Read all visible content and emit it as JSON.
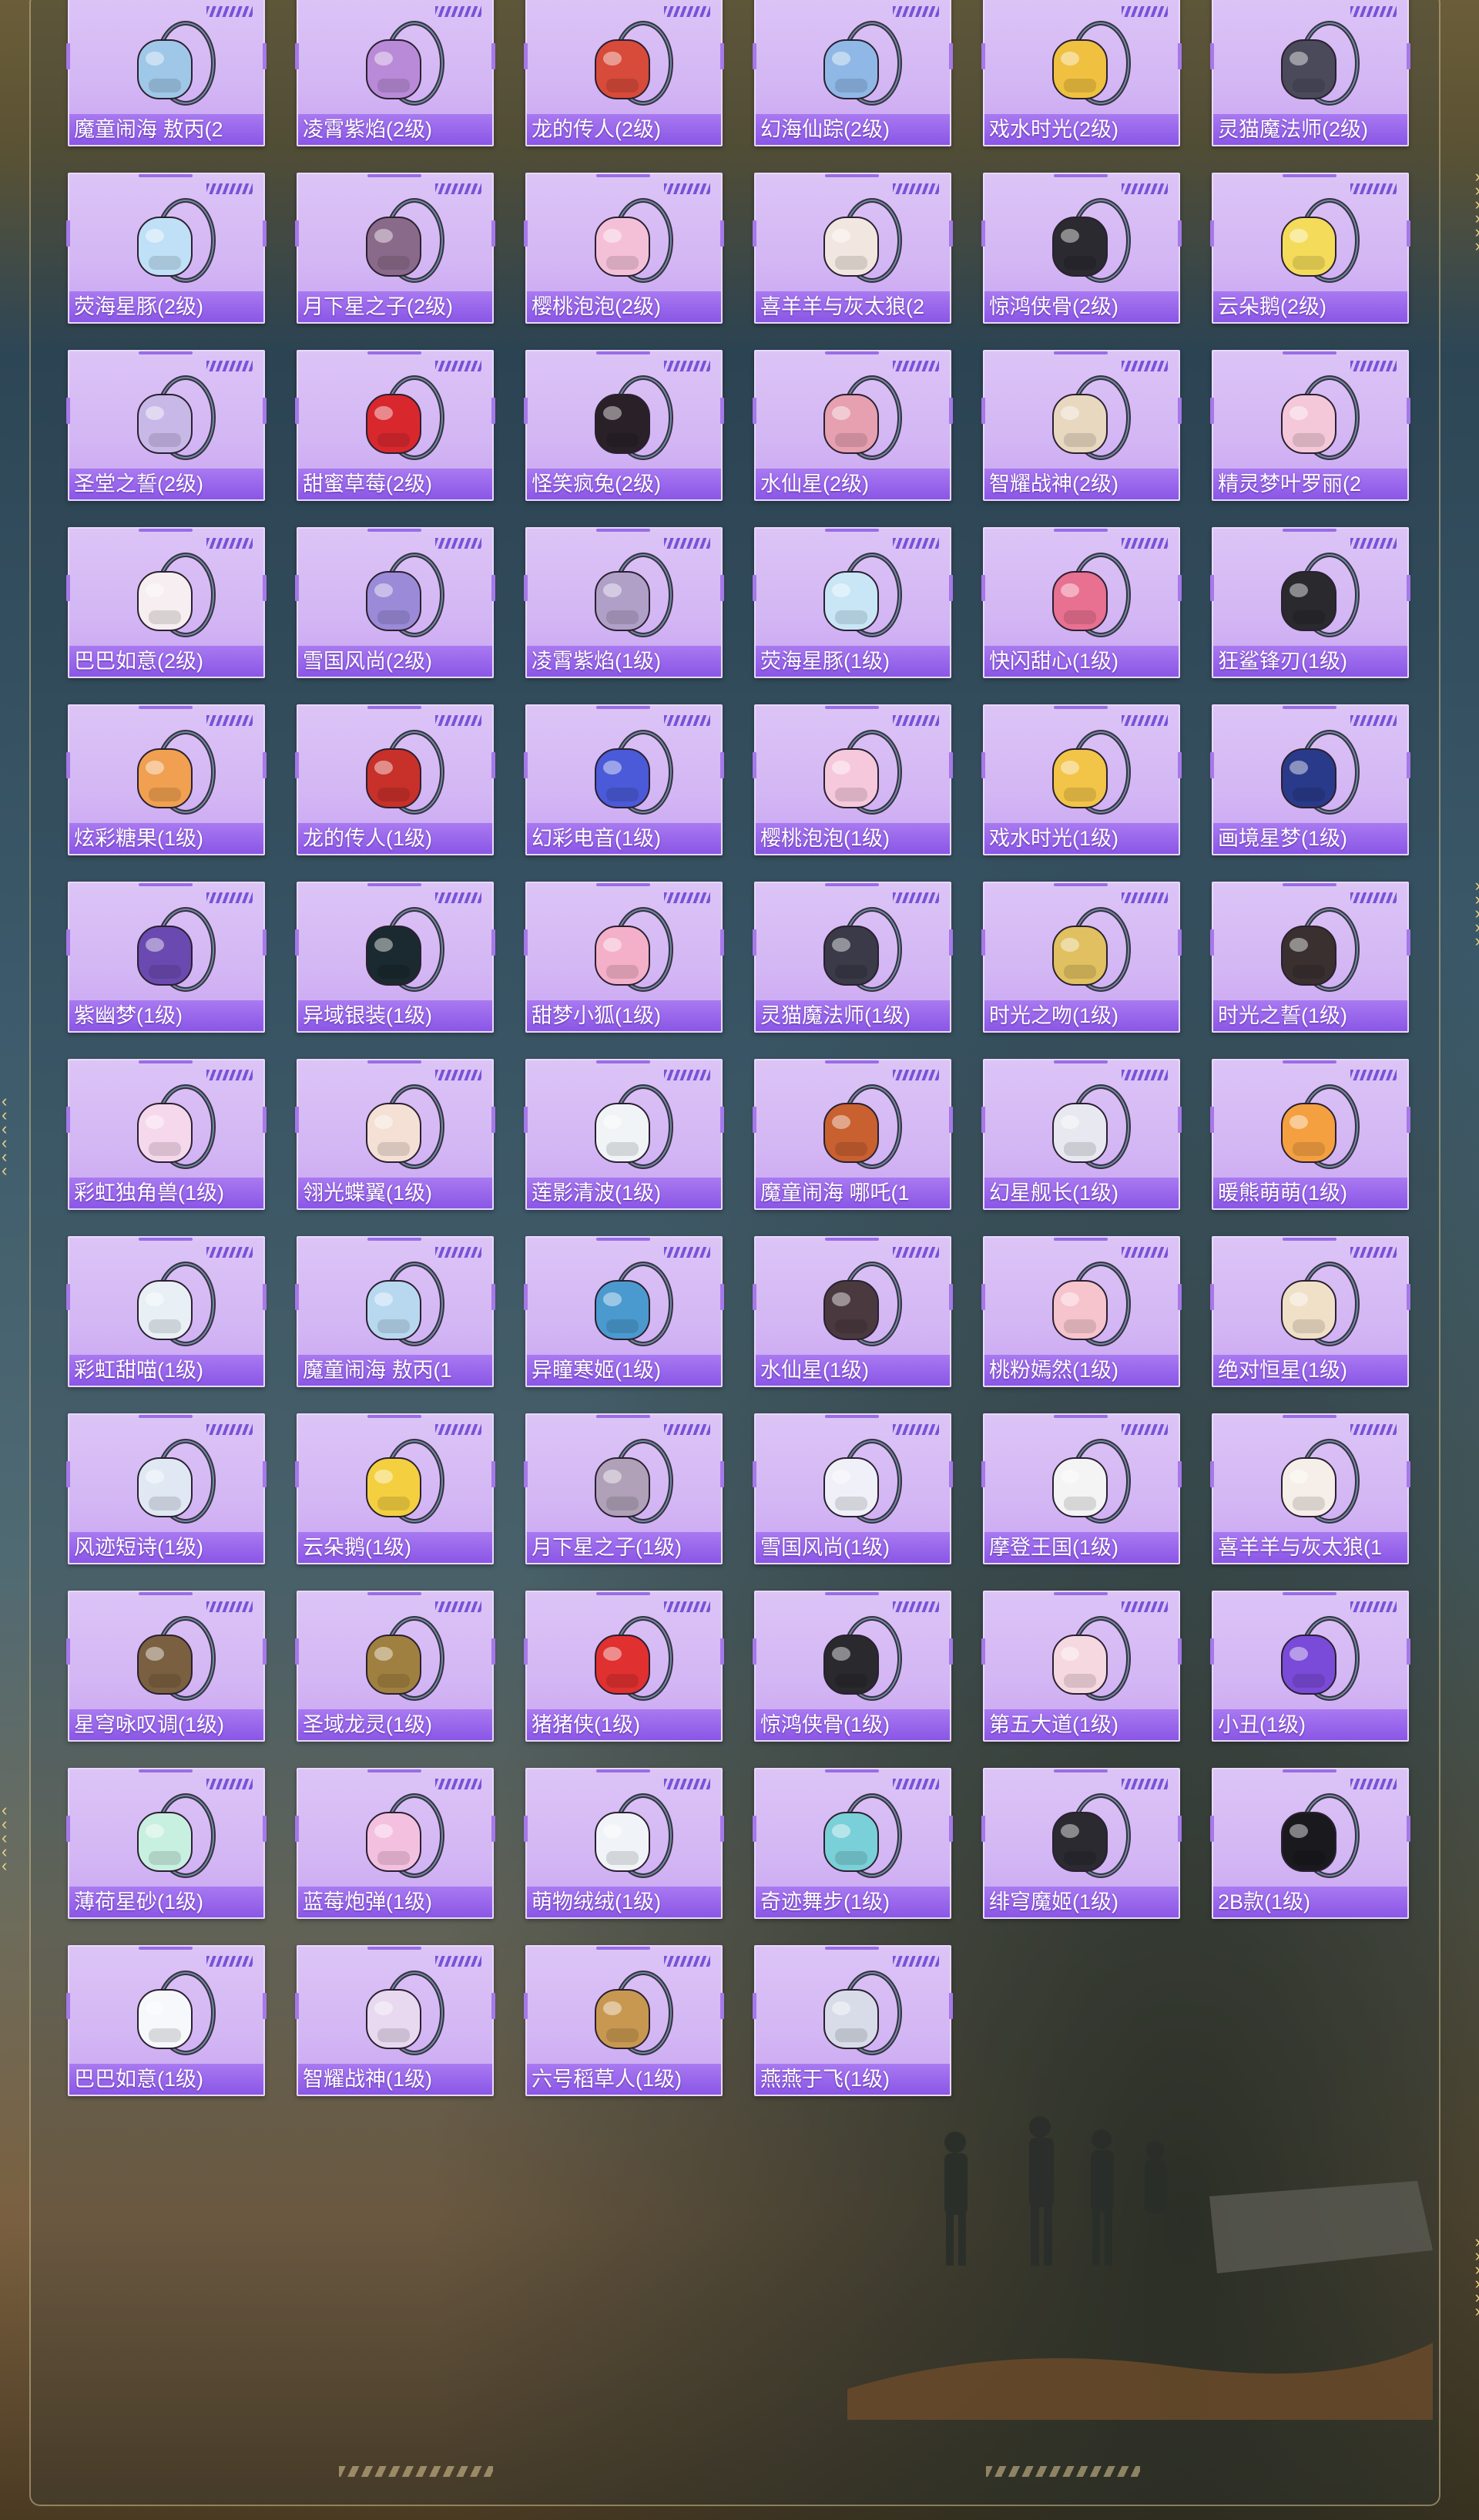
{
  "accent": "#8a56e6",
  "card_bg": "#d3b6f4",
  "items": [
    {
      "label": "魔童闹海 敖丙(2",
      "icon": "backpack-icon",
      "color": "#9fc7e8"
    },
    {
      "label": "凌霄紫焰(2级)",
      "icon": "backpack-icon",
      "color": "#b88ad8"
    },
    {
      "label": "龙的传人(2级)",
      "icon": "backpack-icon",
      "color": "#d84a3a"
    },
    {
      "label": "幻海仙踪(2级)",
      "icon": "backpack-icon",
      "color": "#8fb8e6"
    },
    {
      "label": "戏水时光(2级)",
      "icon": "backpack-icon",
      "color": "#f0c040"
    },
    {
      "label": "灵猫魔法师(2级)",
      "icon": "backpack-icon",
      "color": "#4a4a5a"
    },
    {
      "label": "荧海星豚(2级)",
      "icon": "backpack-icon",
      "color": "#bfe0f6"
    },
    {
      "label": "月下星之子(2级)",
      "icon": "backpack-icon",
      "color": "#8a6a8a"
    },
    {
      "label": "樱桃泡泡(2级)",
      "icon": "backpack-icon",
      "color": "#f4c0d8"
    },
    {
      "label": "喜羊羊与灰太狼(2",
      "icon": "backpack-icon",
      "color": "#f2e6e0"
    },
    {
      "label": "惊鸿侠骨(2级)",
      "icon": "backpack-icon",
      "color": "#2a2a30"
    },
    {
      "label": "云朵鹅(2级)",
      "icon": "backpack-icon",
      "color": "#f4dc5a"
    },
    {
      "label": "圣堂之誓(2级)",
      "icon": "backpack-icon",
      "color": "#c8b8e8"
    },
    {
      "label": "甜蜜草莓(2级)",
      "icon": "backpack-icon",
      "color": "#d8282e"
    },
    {
      "label": "怪笑疯兔(2级)",
      "icon": "backpack-icon",
      "color": "#2a2028"
    },
    {
      "label": "水仙星(2级)",
      "icon": "backpack-icon",
      "color": "#e6a0b0"
    },
    {
      "label": "智耀战神(2级)",
      "icon": "backpack-icon",
      "color": "#e8d8c0"
    },
    {
      "label": "精灵梦叶罗丽(2",
      "icon": "backpack-icon",
      "color": "#f4c8d8"
    },
    {
      "label": "巴巴如意(2级)",
      "icon": "backpack-icon",
      "color": "#f6eef0"
    },
    {
      "label": "雪国风尚(2级)",
      "icon": "backpack-icon",
      "color": "#9a8ad8"
    },
    {
      "label": "凌霄紫焰(1级)",
      "icon": "backpack-icon",
      "color": "#b0a0c8"
    },
    {
      "label": "荧海星豚(1级)",
      "icon": "backpack-icon",
      "color": "#c8e6f6"
    },
    {
      "label": "快闪甜心(1级)",
      "icon": "backpack-icon",
      "color": "#e87090"
    },
    {
      "label": "狂鲨锋刃(1级)",
      "icon": "backpack-icon",
      "color": "#2a2a2e"
    },
    {
      "label": "炫彩糖果(1级)",
      "icon": "backpack-icon",
      "color": "#f0a050"
    },
    {
      "label": "龙的传人(1级)",
      "icon": "backpack-icon",
      "color": "#c8302a"
    },
    {
      "label": "幻彩电音(1级)",
      "icon": "backpack-icon",
      "color": "#4a5ad8"
    },
    {
      "label": "樱桃泡泡(1级)",
      "icon": "backpack-icon",
      "color": "#f6c8dc"
    },
    {
      "label": "戏水时光(1级)",
      "icon": "backpack-icon",
      "color": "#f2c448"
    },
    {
      "label": "画境星梦(1级)",
      "icon": "backpack-icon",
      "color": "#2a3a8a"
    },
    {
      "label": "紫幽梦(1级)",
      "icon": "backpack-icon",
      "color": "#6a4ab0"
    },
    {
      "label": "异域银装(1级)",
      "icon": "backpack-icon",
      "color": "#1a2a30"
    },
    {
      "label": "甜梦小狐(1级)",
      "icon": "backpack-icon",
      "color": "#f4b0c8"
    },
    {
      "label": "灵猫魔法师(1级)",
      "icon": "backpack-icon",
      "color": "#3a3a48"
    },
    {
      "label": "时光之吻(1级)",
      "icon": "backpack-icon",
      "color": "#e0c060"
    },
    {
      "label": "时光之誓(1级)",
      "icon": "backpack-icon",
      "color": "#3a3030"
    },
    {
      "label": "彩虹独角兽(1级)",
      "icon": "backpack-icon",
      "color": "#f6d8ec"
    },
    {
      "label": "翎光蝶翼(1级)",
      "icon": "backpack-icon",
      "color": "#f4e0d4"
    },
    {
      "label": "莲影清波(1级)",
      "icon": "backpack-icon",
      "color": "#f0f4f6"
    },
    {
      "label": "魔童闹海 哪吒(1",
      "icon": "backpack-icon",
      "color": "#c86030"
    },
    {
      "label": "幻星舰长(1级)",
      "icon": "backpack-icon",
      "color": "#e8e8f0"
    },
    {
      "label": "暖熊萌萌(1级)",
      "icon": "backpack-icon",
      "color": "#f4a040"
    },
    {
      "label": "彩虹甜喵(1级)",
      "icon": "backpack-icon",
      "color": "#e8f0f6"
    },
    {
      "label": "魔童闹海 敖丙(1",
      "icon": "backpack-icon",
      "color": "#b8d8f0"
    },
    {
      "label": "异瞳寒姬(1级)",
      "icon": "backpack-icon",
      "color": "#4a9ad0"
    },
    {
      "label": "水仙星(1级)",
      "icon": "backpack-icon",
      "color": "#4a3a40"
    },
    {
      "label": "桃粉嫣然(1级)",
      "icon": "backpack-icon",
      "color": "#f6c4cc"
    },
    {
      "label": "绝对恒星(1级)",
      "icon": "backpack-icon",
      "color": "#f0e0c8"
    },
    {
      "label": "风迹短诗(1级)",
      "icon": "backpack-icon",
      "color": "#e0e8f4"
    },
    {
      "label": "云朵鹅(1级)",
      "icon": "backpack-icon",
      "color": "#f4d040"
    },
    {
      "label": "月下星之子(1级)",
      "icon": "backpack-icon",
      "color": "#b0a0b8"
    },
    {
      "label": "雪国风尚(1级)",
      "icon": "backpack-icon",
      "color": "#f0f0f8"
    },
    {
      "label": "摩登王国(1级)",
      "icon": "backpack-icon",
      "color": "#f4f4f4"
    },
    {
      "label": "喜羊羊与灰太狼(1",
      "icon": "backpack-icon",
      "color": "#f6eee8"
    },
    {
      "label": "星穹咏叹调(1级)",
      "icon": "backpack-icon",
      "color": "#7a6040"
    },
    {
      "label": "圣域龙灵(1级)",
      "icon": "backpack-icon",
      "color": "#a08040"
    },
    {
      "label": "猪猪侠(1级)",
      "icon": "backpack-icon",
      "color": "#e03030"
    },
    {
      "label": "惊鸿侠骨(1级)",
      "icon": "backpack-icon",
      "color": "#2a2a2e"
    },
    {
      "label": "第五大道(1级)",
      "icon": "backpack-icon",
      "color": "#f6d8e0"
    },
    {
      "label": "小丑(1级)",
      "icon": "backpack-icon",
      "color": "#7a4ad8"
    },
    {
      "label": "薄荷星砂(1级)",
      "icon": "backpack-icon",
      "color": "#c8f0e0"
    },
    {
      "label": "蓝莓炮弹(1级)",
      "icon": "backpack-icon",
      "color": "#f4c0e0"
    },
    {
      "label": "萌物绒绒(1级)",
      "icon": "backpack-icon",
      "color": "#f0f4f8"
    },
    {
      "label": "奇迹舞步(1级)",
      "icon": "backpack-icon",
      "color": "#7ad0d8"
    },
    {
      "label": "绯穹魔姬(1级)",
      "icon": "backpack-icon",
      "color": "#2a2a30"
    },
    {
      "label": "2B款(1级)",
      "icon": "backpack-icon",
      "color": "#1a1a1e"
    },
    {
      "label": "巴巴如意(1级)",
      "icon": "backpack-icon",
      "color": "#f6f8fc"
    },
    {
      "label": "智耀战神(1级)",
      "icon": "backpack-icon",
      "color": "#e8d8f0"
    },
    {
      "label": "六号稻草人(1级)",
      "icon": "backpack-icon",
      "color": "#c89850"
    },
    {
      "label": "燕燕于飞(1级)",
      "icon": "backpack-icon",
      "color": "#d8dce8"
    }
  ]
}
